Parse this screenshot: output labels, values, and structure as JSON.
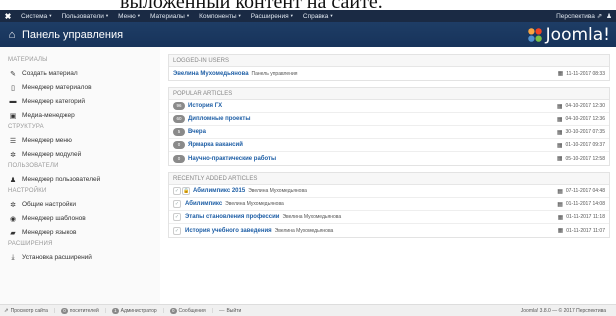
{
  "page_top_text": "выложенный контент на сайте.",
  "menubar": {
    "items": [
      "Система",
      "Пользователи",
      "Меню",
      "Материалы",
      "Компоненты",
      "Расширения",
      "Справка"
    ],
    "right": "Перспектива ⇗"
  },
  "header": {
    "title": "Панель управления",
    "logo_text": "Joomla!"
  },
  "sidebar": {
    "sections": [
      {
        "title": "МАТЕРИАЛЫ",
        "items": [
          {
            "label": "Создать материал",
            "icon": "pencil-icon",
            "glyph": "✎"
          },
          {
            "label": "Менеджер материалов",
            "icon": "file-icon",
            "glyph": "▯"
          },
          {
            "label": "Менеджер категорий",
            "icon": "folder-icon",
            "glyph": "▬"
          },
          {
            "label": "Медиа-менеджер",
            "icon": "image-icon",
            "glyph": "▣"
          }
        ]
      },
      {
        "title": "СТРУКТУРА",
        "items": [
          {
            "label": "Менеджер меню",
            "icon": "list-icon",
            "glyph": "☰"
          },
          {
            "label": "Менеджер модулей",
            "icon": "cube-icon",
            "glyph": "✲"
          }
        ]
      },
      {
        "title": "ПОЛЬЗОВАТЕЛИ",
        "items": [
          {
            "label": "Менеджер пользователей",
            "icon": "users-icon",
            "glyph": "♟"
          }
        ]
      },
      {
        "title": "НАСТРОЙКИ",
        "items": [
          {
            "label": "Общие настройки",
            "icon": "gear-icon",
            "glyph": "✲"
          },
          {
            "label": "Менеджер шаблонов",
            "icon": "eye-icon",
            "glyph": "◉"
          },
          {
            "label": "Менеджер языков",
            "icon": "comment-icon",
            "glyph": "▰"
          }
        ]
      },
      {
        "title": "РАСШИРЕНИЯ",
        "items": [
          {
            "label": "Установка расширений",
            "icon": "upload-icon",
            "glyph": "⤓"
          }
        ]
      }
    ]
  },
  "logged_in": {
    "title": "LOGGED-IN USERS",
    "rows": [
      {
        "name": "Эвелина Мухомедьянова",
        "meta": "Панель управления",
        "date": "11-11-2017 08:33"
      }
    ]
  },
  "popular": {
    "title": "POPULAR ARTICLES",
    "rows": [
      {
        "count": "96",
        "title": "История ГХ",
        "date": "04-10-2017 12:30"
      },
      {
        "count": "60",
        "title": "Дипломные проекты",
        "date": "04-10-2017 12:36"
      },
      {
        "count": "5",
        "title": "Вчера",
        "date": "30-10-2017 07:35"
      },
      {
        "count": "0",
        "title": "Ярмарка вакансий",
        "date": "01-10-2017 09:37"
      },
      {
        "count": "0",
        "title": "Научно-практические работы",
        "date": "05-10-2017 12:58"
      }
    ]
  },
  "recent": {
    "title": "RECENTLY ADDED ARTICLES",
    "rows": [
      {
        "title": "Абилимпикс 2015",
        "author": "Эвелина Мухомедьянова",
        "date": "07-11-2017 04:48",
        "locked": true
      },
      {
        "title": "Абилимпикс",
        "author": "Эвелина Мухомедьянова",
        "date": "01-11-2017 14:08",
        "locked": false
      },
      {
        "title": "Этапы становления профессии",
        "author": "Эвелина Мухомедьянова",
        "date": "01-11-2017 11:18",
        "locked": false
      },
      {
        "title": "История учебного заведения",
        "author": "Эвелина Мухомедьянова",
        "date": "01-11-2017 11:07",
        "locked": false
      }
    ]
  },
  "statusbar": {
    "view_site": "Просмотр сайта",
    "visitors_count": "0",
    "visitors_label": "посетителей",
    "admins_count": "1",
    "admins_label": "Администратор",
    "messages_count": "0",
    "messages_label": "Сообщения",
    "logout": "Выйти",
    "version": "Joomla! 3.8.0 — © 2017 Перспектива"
  },
  "colors": {
    "menubar_bg": "#1a2a44",
    "header_bg": "#1e3d66",
    "link": "#1f5fa6"
  }
}
